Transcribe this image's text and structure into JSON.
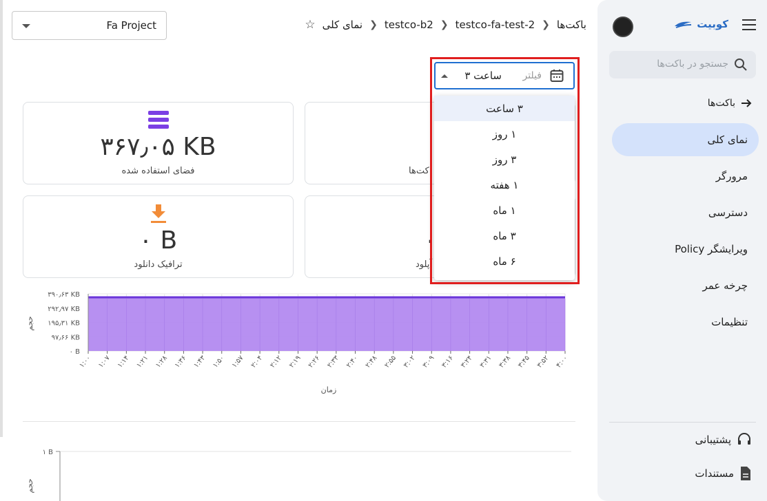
{
  "sidebar": {
    "brand": "کوبیت",
    "search_placeholder": "جستجو در باکت‌ها",
    "back_label": "باکت‌ها",
    "items": [
      {
        "label": "نمای کلی",
        "active": true
      },
      {
        "label": "مرورگر"
      },
      {
        "label": "دسترسی"
      },
      {
        "label": "ویرایشگر Policy"
      },
      {
        "label": "چرخه عمر"
      },
      {
        "label": "تنظیمات"
      }
    ],
    "support_label": "پشتیبانی",
    "docs_label": "مستندات"
  },
  "header": {
    "project": "Fa Project",
    "breadcrumb": [
      "باکت‌ها",
      "testco-fa-test-2",
      "testco-b2",
      "نمای کلی"
    ]
  },
  "filter": {
    "label": "فیلتر",
    "value": "۳ ساعت",
    "options": [
      "۳ ساعت",
      "۱ روز",
      "۳ روز",
      "۱ هفته",
      "۱ ماه",
      "۳ ماه",
      "۶ ماه"
    ]
  },
  "cards": {
    "storage": {
      "value": "۳۶۷٫۰۵ KB",
      "label": "فضای استفاده شده"
    },
    "objects_label_part": "کت‌ها",
    "download": {
      "value": "۰ B",
      "label": "ترافیک دانلود"
    },
    "upload_value_part": "۰",
    "upload_label_part": "آپلود"
  },
  "colors": {
    "accent": "#1f6fd1",
    "chart_fill": "#b38af0",
    "chart_line": "#6a35d9",
    "storage_icon": "#7b3fe4",
    "download_icon": "#f28c38"
  },
  "chart_data": [
    {
      "type": "area",
      "ylabel": "حجم",
      "xlabel": "زمان",
      "yticks": [
        "۰ B",
        "۹۷٫۶۶ KB",
        "۱۹۵٫۳۱ KB",
        "۲۹۲٫۹۷ KB",
        "۳۹۰٫۶۳ KB"
      ],
      "ylim": [
        0,
        390.63
      ],
      "x": [
        "۱:۰۰",
        "۱:۰۷",
        "۱:۱۴",
        "۱:۲۱",
        "۱:۲۸",
        "۱:۳۶",
        "۱:۴۳",
        "۱:۵۰",
        "۱:۵۷",
        "۲:۰۴",
        "۲:۱۲",
        "۲:۱۹",
        "۲:۲۶",
        "۲:۳۳",
        "۲:۴۰",
        "۲:۴۸",
        "۲:۵۵",
        "۳:۰۲",
        "۳:۰۹",
        "۳:۱۶",
        "۳:۲۴",
        "۳:۳۱",
        "۳:۳۸",
        "۳:۴۵",
        "۳:۵۲",
        "۴:۰۰"
      ],
      "series": [
        {
          "values": [
            367.05,
            367.05,
            367.05,
            367.05,
            367.05,
            367.05,
            367.05,
            367.05,
            367.05,
            367.05,
            367.05,
            367.05,
            367.05,
            367.05,
            367.05,
            367.05,
            367.05,
            367.05,
            367.05,
            367.05,
            367.05,
            367.05,
            367.05,
            367.05,
            367.05,
            367.05
          ]
        }
      ]
    },
    {
      "type": "line",
      "ylabel": "حجم",
      "yticks": [
        "۱ B"
      ]
    }
  ]
}
